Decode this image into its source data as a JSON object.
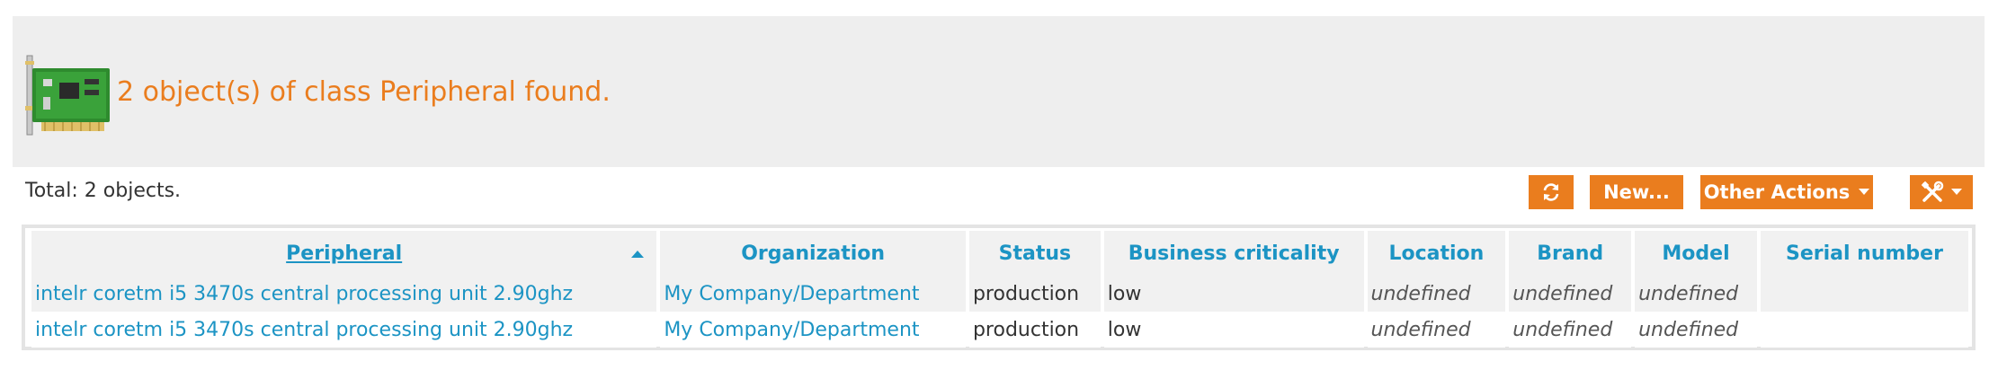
{
  "header": {
    "title": "2 object(s) of class Peripheral found.",
    "icon": "peripheral-card-icon"
  },
  "summary": {
    "total": "Total: 2 objects."
  },
  "toolbar": {
    "refresh_icon": "refresh-icon",
    "new_label": "New...",
    "other_actions_label": "Other Actions",
    "tools_icon": "tools-icon",
    "accent_color": "#ea7d1e"
  },
  "table": {
    "columns": [
      "Peripheral",
      "Organization",
      "Status",
      "Business criticality",
      "Location",
      "Brand",
      "Model",
      "Serial number"
    ],
    "sorted_column": "Peripheral",
    "sort_direction": "ascending",
    "rows": [
      {
        "peripheral": "intelr coretm i5 3470s central processing unit 2.90ghz",
        "organization": "My Company/Department",
        "status": "production",
        "criticality": "low",
        "location": "undefined",
        "brand": "undefined",
        "model": "undefined",
        "serial": ""
      },
      {
        "peripheral": "intelr coretm i5 3470s central processing unit 2.90ghz",
        "organization": "My Company/Department",
        "status": "production",
        "criticality": "low",
        "location": "undefined",
        "brand": "undefined",
        "model": "undefined",
        "serial": ""
      }
    ]
  },
  "colors": {
    "link": "#1c94c4",
    "header_bg": "#eeeeee",
    "title": "#ea7d1e"
  }
}
